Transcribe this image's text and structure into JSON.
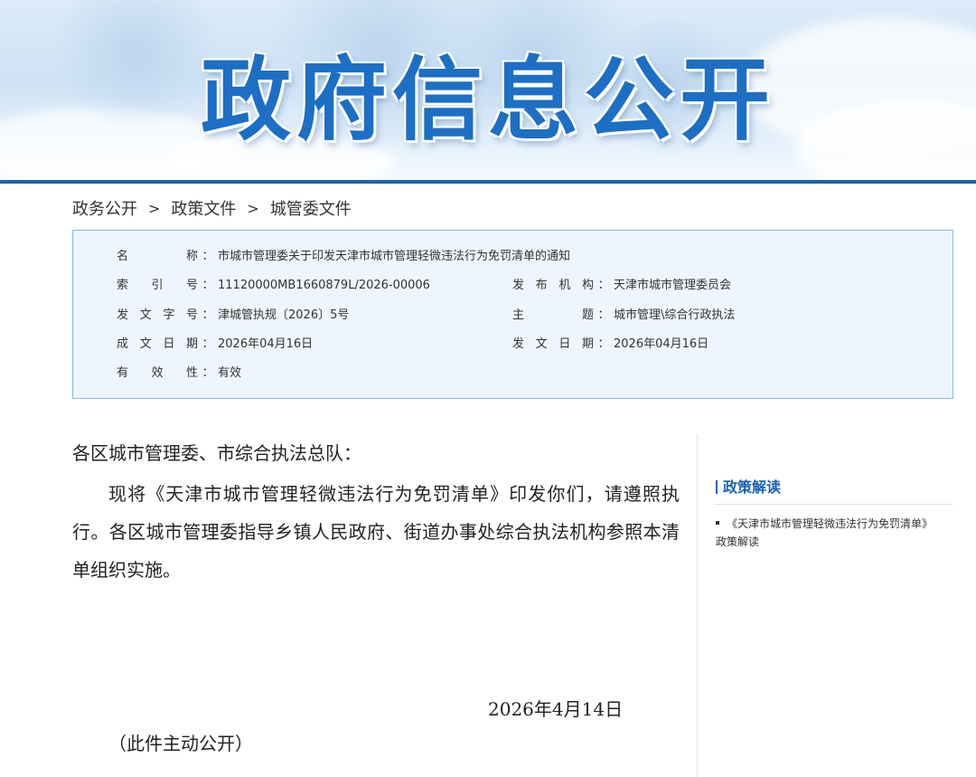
{
  "banner": {
    "title": "政府信息公开"
  },
  "breadcrumb": {
    "items": [
      "政务公开",
      "政策文件",
      "城管委文件"
    ],
    "separator": ">"
  },
  "info": {
    "name_label": "名称",
    "name_value": "市城市管理委关于印发天津市城市管理轻微违法行为免罚清单的通知",
    "index_label": "索引号",
    "index_value": "11120000MB1660879L/2026-00006",
    "issuer_label": "发布机构",
    "issuer_value": "天津市城市管理委员会",
    "doc_no_label": "发文字号",
    "doc_no_value": "津城管执规〔2026〕5号",
    "topic_label": "主题",
    "topic_value": "城市管理\\综合行政执法",
    "written_date_label": "成文日期",
    "written_date_value": "2026年04月16日",
    "issue_date_label": "发文日期",
    "issue_date_value": "2026年04月16日",
    "validity_label": "有效性",
    "validity_value": "有效",
    "colon": "："
  },
  "body": {
    "salutation": "各区城市管理委、市综合执法总队：",
    "paragraph": "现将《天津市城市管理轻微违法行为免罚清单》印发你们，请遵照执行。各区城市管理委指导乡镇人民政府、街道办事处综合执法机构参照本清单组织实施。",
    "date": "2026年4月14日",
    "note": "（此件主动公开）"
  },
  "sidebar": {
    "title": "政策解读",
    "link": "《天津市城市管理轻微违法行为免罚清单》政策解读"
  },
  "colors": {
    "brand_blue": "#1c6fc4",
    "rule_blue": "#1e62a8",
    "box_bg": "#eef5fc",
    "box_border": "#8bb6e0",
    "side_blue": "#1a63b3"
  }
}
